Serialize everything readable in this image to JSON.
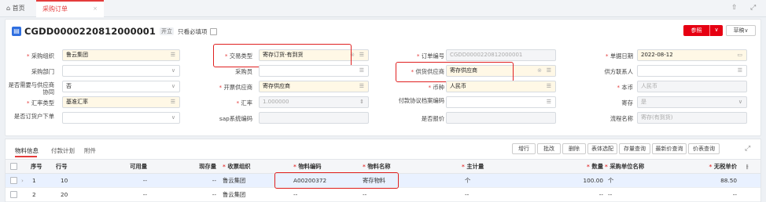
{
  "tabs": {
    "home": "⌂ 首页",
    "active": "采购订单",
    "close": "×",
    "icon_pin": "⇧",
    "icon_expand": "⤢"
  },
  "header": {
    "doc_no": "CGDD0000220812000001",
    "status_badge": "开立",
    "required_only_label": "只看必填项",
    "ref_button": "参照",
    "ref_arrow": "∨",
    "draft_button": "草稿∨"
  },
  "fields": {
    "org_label": "采购组织",
    "org_value": "鲁云集团",
    "dept_label": "采购部门",
    "dept_value": "",
    "supply_label": "是否需要与供应商协同",
    "supply_value": "否",
    "rate_type_label": "汇率类型",
    "rate_type_value": "基准汇率",
    "order_to_label": "是否订货户下单",
    "order_to_value": "",
    "trade_label": "交易类型",
    "trade_value": "寄存订货-有到货",
    "buyer_label": "采购员",
    "buyer_value": "",
    "invoice_supplier_label": "开票供应商",
    "invoice_supplier_value": "寄存供应商",
    "rate_label": "汇率",
    "rate_value": "1.000000",
    "sap_label": "sap系统编码",
    "sap_value": "",
    "order_no_label": "订单编号",
    "order_no_value": "CGDD0000220812000001",
    "supplier_label": "供货供应商",
    "supplier_value": "寄存供应商",
    "currency_label": "币种",
    "currency_value": "人民币",
    "pay_agreement_label": "付款协议档案编码",
    "pay_agreement_value": "",
    "quoted_label": "是否报价",
    "quoted_value": "",
    "date_label": "单据日期",
    "date_value": "2022-08-12",
    "contact_label": "供方联系人",
    "contact_value": "",
    "local_currency_label": "本币",
    "local_currency_value": "人民币",
    "consign_label": "寄存",
    "consign_value": "是",
    "flow_label": "流程名称",
    "flow_value": "寄存(有到货)"
  },
  "grid": {
    "tabs": [
      "物料信息",
      "付款计划",
      "附件"
    ],
    "buttons": [
      "增行",
      "批改",
      "删除",
      "表体选配",
      "存量查询",
      "最新价查询",
      "价表查询"
    ],
    "expand_icon": "⤢",
    "headers": {
      "seq": "序号",
      "line": "行号",
      "available": "可用量",
      "onhand": "现存量",
      "receive_org": "收票组织",
      "material_code": "物料编码",
      "material_name": "物料名称",
      "main_unit": "主计量",
      "qty": "数量",
      "purchase_unit": "采购单位名称",
      "price": "无税单价",
      "col_icon": "⫲"
    },
    "rows": [
      {
        "seq": "1",
        "line": "10",
        "available": "--",
        "onhand": "--",
        "receive_org": "鲁云集团",
        "material_code": "A00200372",
        "material_name": "寄存物料",
        "main_unit": "个",
        "qty": "100.00",
        "purchase_unit": "个",
        "price": "88.50"
      },
      {
        "seq": "2",
        "line": "20",
        "available": "--",
        "onhand": "--",
        "receive_org": "鲁云集团",
        "material_code": "--",
        "material_name": "--",
        "main_unit": "--",
        "qty": "--",
        "purchase_unit": "--",
        "price": "--"
      }
    ]
  }
}
